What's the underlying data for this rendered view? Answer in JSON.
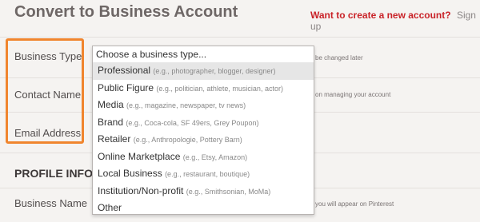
{
  "title": "Convert to Business Account",
  "signup_prompt": {
    "question": "Want to create a new account?",
    "link": "Sign up"
  },
  "fields": {
    "business_type": "Business Type",
    "contact_name": "Contact Name",
    "email": "Email Address"
  },
  "profile_section": {
    "heading": "PROFILE INFO (",
    "business_name_label": "Business Name"
  },
  "helpers": {
    "type_note": "be changed later",
    "contact_note": "on managing your account",
    "name_note": "you will appear on Pinterest"
  },
  "dropdown": {
    "current": "Choose a business type...",
    "options": [
      {
        "label": "Professional",
        "example": "(e.g., photographer, blogger, designer)",
        "selected": true
      },
      {
        "label": "Public Figure",
        "example": "(e.g., politician, athlete, musician, actor)"
      },
      {
        "label": "Media",
        "example": "(e.g., magazine, newspaper, tv news)"
      },
      {
        "label": "Brand",
        "example": "(e.g., Coca-cola, SF 49ers, Grey Poupon)"
      },
      {
        "label": "Retailer",
        "example": "(e.g., Anthropologie, Pottery Barn)"
      },
      {
        "label": "Online Marketplace",
        "example": "(e.g., Etsy, Amazon)"
      },
      {
        "label": "Local Business",
        "example": "(e.g., restaurant, boutique)"
      },
      {
        "label": "Institution/Non-profit",
        "example": "(e.g., Smithsonian, MoMa)"
      },
      {
        "label": "Other",
        "example": ""
      }
    ]
  },
  "colors": {
    "accent_red": "#c92228",
    "highlight_orange": "#f0852e"
  }
}
